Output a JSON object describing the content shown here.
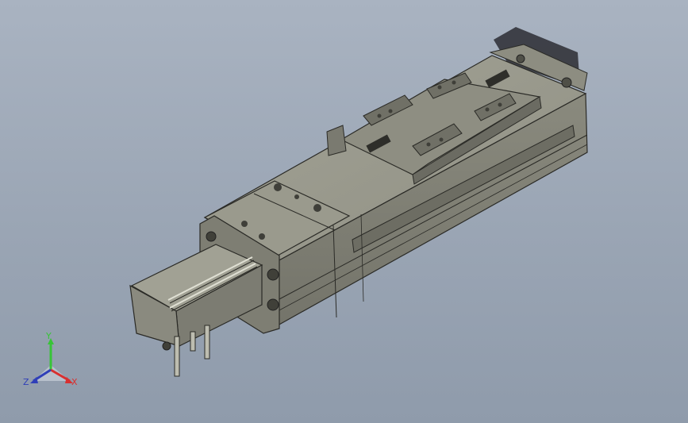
{
  "viewport": {
    "background_top": "#a9b3c1",
    "background_bottom": "#8f9bab"
  },
  "model": {
    "body_color": "#8c8c80",
    "top_color": "#9d9d90",
    "dark_color": "#5f5f55",
    "edge_color": "#2a2a26",
    "shadow_color": "#2b2d33"
  },
  "triad": {
    "x_label": "X",
    "y_label": "Y",
    "z_label": "Z",
    "x_color": "#d83030",
    "y_color": "#37c437",
    "z_color": "#2f3fb8"
  }
}
